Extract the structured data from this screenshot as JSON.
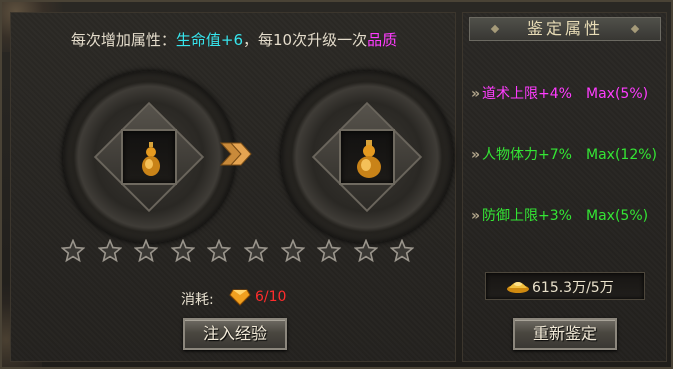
{
  "info": {
    "prefix": "每次增加属性：",
    "attr": "生命值+6",
    "middle": "，每10次升级一次",
    "quality": "品质"
  },
  "stars": {
    "total": 10,
    "filled": 0
  },
  "consume": {
    "label": "消耗:",
    "icon": "gem-icon",
    "count": "6/10"
  },
  "buttons": {
    "inject": "注入经验",
    "reidentify": "重新鉴定"
  },
  "right_panel": {
    "title": "鉴定属性",
    "attributes": [
      {
        "name": "道术上限+4%",
        "max": "Max(5%)",
        "color": "#ff3cff"
      },
      {
        "name": "人物体力+7%",
        "max": "Max(12%)",
        "color": "#34e634"
      },
      {
        "name": "防御上限+3%",
        "max": "Max(5%)",
        "color": "#34e634"
      }
    ],
    "gold": {
      "icon": "gold-ingot-icon",
      "text": "615.3万/5万"
    }
  },
  "colors": {
    "cyan": "#37e6ee",
    "magenta": "#ff3cff",
    "green": "#34e634",
    "red": "#ff2c2c"
  }
}
